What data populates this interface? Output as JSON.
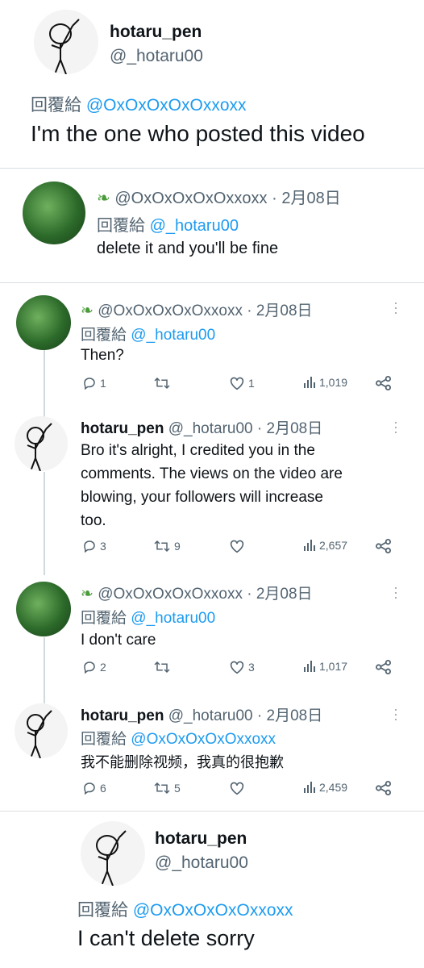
{
  "colors": {
    "link": "#1d9bf0",
    "muted": "#536471",
    "text": "#0f1419",
    "divider": "#d9dee2"
  },
  "top_post": {
    "name": "hotaru_pen",
    "handle": "@_hotaru00",
    "reply_prefix": "回覆給",
    "reply_to": "@OxOxOxOxOxxoxx",
    "text": "I'm the one who posted this video"
  },
  "quoted_reply": {
    "leaf_icon": "leaf-icon",
    "handle": "@OxOxOxOxOxxoxx",
    "sep": "·",
    "date": "2月08日",
    "reply_prefix": "回覆給",
    "reply_to": "@_hotaru00",
    "text": "delete it and you'll be fine"
  },
  "thread": [
    {
      "author_type": "leaf",
      "handle": "@OxOxOxOxOxxoxx",
      "sep": "·",
      "date": "2月08日",
      "reply_prefix": "回覆給",
      "reply_to": "@_hotaru00",
      "text": "Then?",
      "stats": {
        "replies": "1",
        "retweets": "",
        "likes": "1",
        "views": "1,019"
      }
    },
    {
      "author_type": "stick",
      "name": "hotaru_pen",
      "handle": "@_hotaru00",
      "sep": "·",
      "date": "2月08日",
      "text_lines": [
        "Bro it's alright, I credited you in the",
        "comments. The views on the video are",
        "blowing, your followers will increase",
        "too."
      ],
      "stats": {
        "replies": "3",
        "retweets": "9",
        "likes": "",
        "views": "2,657"
      }
    },
    {
      "author_type": "leaf",
      "handle": "@OxOxOxOxOxxoxx",
      "sep": "·",
      "date": "2月08日",
      "reply_prefix": "回覆給",
      "reply_to": "@_hotaru00",
      "text": "I don't care",
      "stats": {
        "replies": "2",
        "retweets": "",
        "likes": "3",
        "views": "1,017"
      }
    },
    {
      "author_type": "stick",
      "name": "hotaru_pen",
      "handle": "@_hotaru00",
      "sep": "·",
      "date": "2月08日",
      "reply_prefix": "回覆給",
      "reply_to": "@OxOxOxOxOxxoxx",
      "text": "我不能删除视频，我真的很抱歉",
      "stats": {
        "replies": "6",
        "retweets": "5",
        "likes": "",
        "views": "2,459"
      }
    }
  ],
  "bottom_post": {
    "name": "hotaru_pen",
    "handle": "@_hotaru00",
    "reply_prefix": "回覆給",
    "reply_to": "@OxOxOxOxOxxoxx",
    "text": "I can't delete sorry"
  }
}
